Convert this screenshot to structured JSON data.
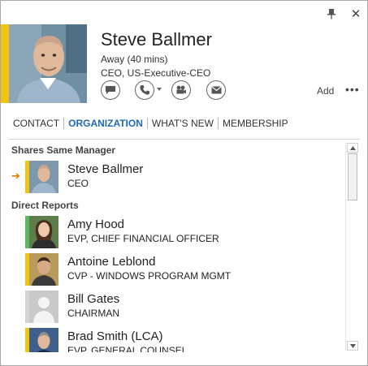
{
  "window": {
    "pin_icon": "pin-icon",
    "close_icon": "close-icon",
    "close_glyph": "✕"
  },
  "contact": {
    "name": "Steve Ballmer",
    "status": "Away (40 mins)",
    "title": "CEO, US-Executive-CEO",
    "presence_color": "#f1c40f"
  },
  "actions": {
    "add_label": "Add",
    "more_label": "•••",
    "icons": [
      "instant-message-icon",
      "phone-icon",
      "video-call-icon",
      "email-icon"
    ]
  },
  "tabs": [
    {
      "label": "CONTACT",
      "active": false
    },
    {
      "label": "ORGANIZATION",
      "active": true
    },
    {
      "label": "WHAT'S NEW",
      "active": false
    },
    {
      "label": "MEMBERSHIP",
      "active": false
    }
  ],
  "groups": {
    "same_manager": {
      "header": "Shares Same Manager",
      "people": [
        {
          "name": "Steve Ballmer",
          "role": "CEO",
          "presence": "#f1c40f",
          "current": true
        }
      ]
    },
    "direct_reports": {
      "header": "Direct Reports",
      "people": [
        {
          "name": "Amy Hood",
          "role": "EVP, CHIEF FINANCIAL OFFICER",
          "presence": "#5cb85c"
        },
        {
          "name": "Antoine Leblond",
          "role": "CVP - WINDOWS PROGRAM MGMT",
          "presence": "#f1c40f"
        },
        {
          "name": "Bill Gates",
          "role": "CHAIRMAN",
          "presence": "#d3d3d3"
        },
        {
          "name": "Brad Smith (LCA)",
          "role": "EVP, GENERAL COUNSEL",
          "presence": "#f1c40f"
        }
      ]
    }
  },
  "colors": {
    "accent": "#1e6bb8",
    "current_arrow": "#e07b00"
  }
}
